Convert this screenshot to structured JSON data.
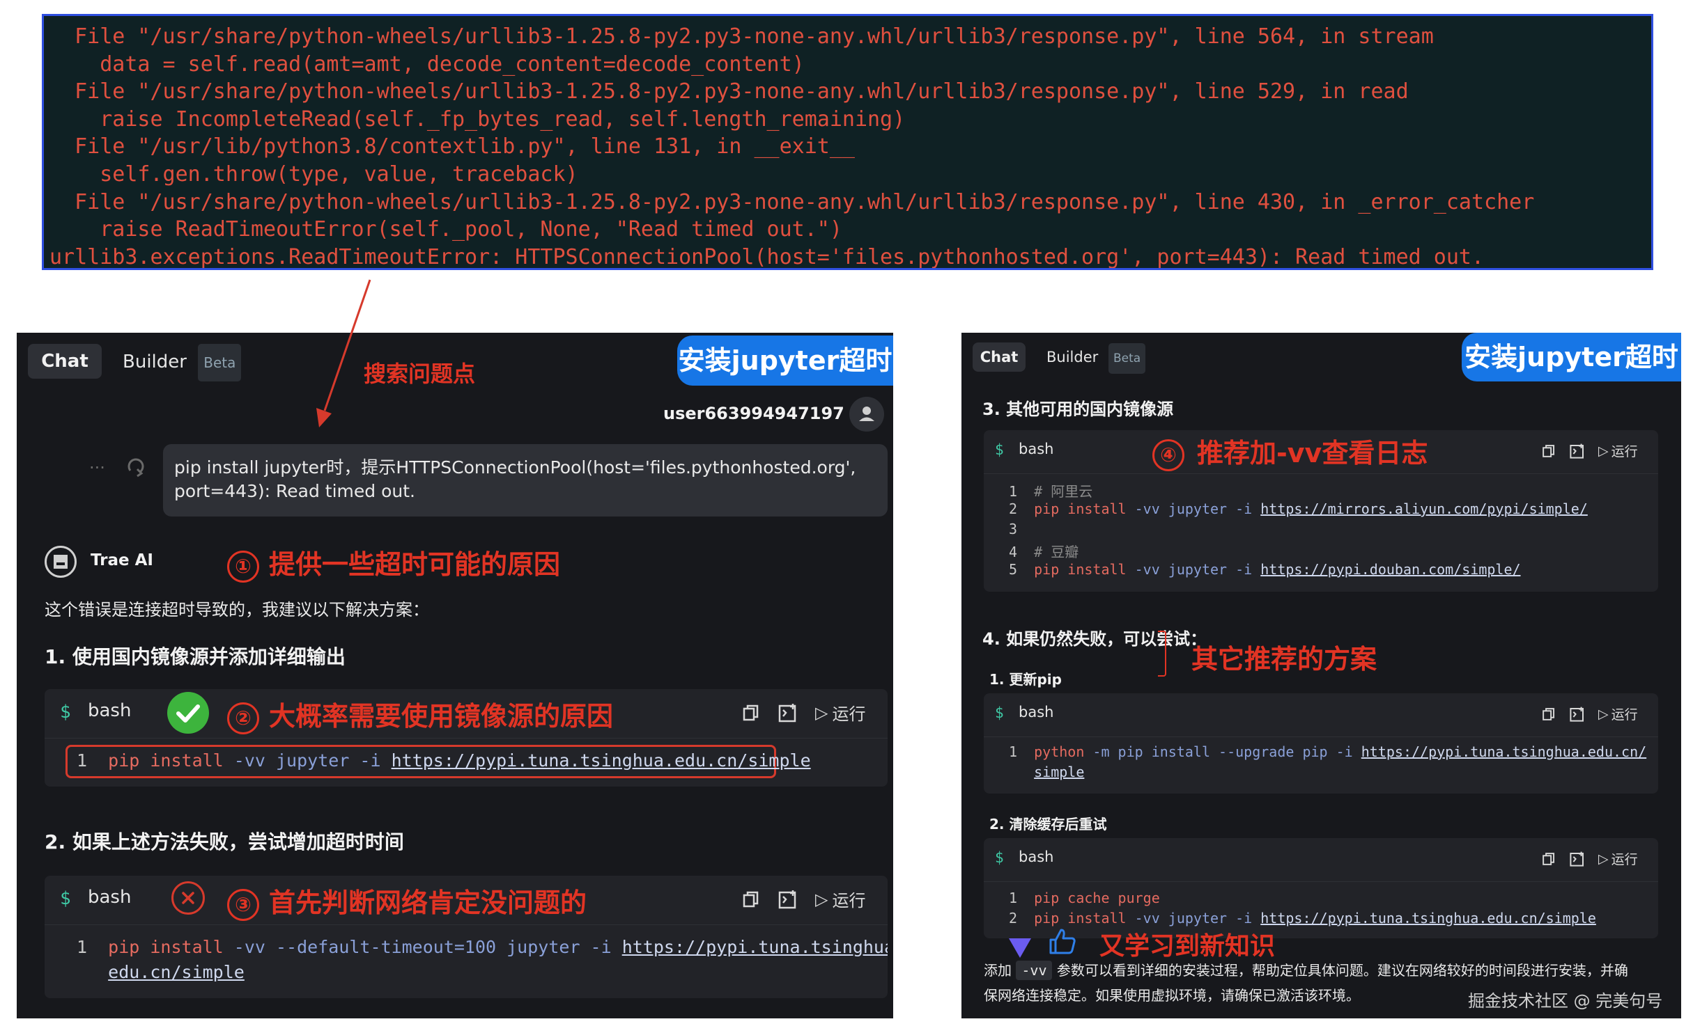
{
  "terminal": {
    "lines": [
      "  File \"/usr/share/python-wheels/urllib3-1.25.8-py2.py3-none-any.whl/urllib3/response.py\", line 564, in stream",
      "    data = self.read(amt=amt, decode_content=decode_content)",
      "  File \"/usr/share/python-wheels/urllib3-1.25.8-py2.py3-none-any.whl/urllib3/response.py\", line 529, in read",
      "    raise IncompleteRead(self._fp_bytes_read, self.length_remaining)",
      "  File \"/usr/lib/python3.8/contextlib.py\", line 131, in __exit__",
      "    self.gen.throw(type, value, traceback)",
      "  File \"/usr/share/python-wheels/urllib3-1.25.8-py2.py3-none-any.whl/urllib3/response.py\", line 430, in _error_catcher",
      "    raise ReadTimeoutError(self._pool, None, \"Read timed out.\")",
      "urllib3.exceptions.ReadTimeoutError: HTTPSConnectionPool(host='files.pythonhosted.org', port=443): Read timed out."
    ],
    "border_color": "#2f4fe0",
    "text_color": "#e0503f"
  },
  "left": {
    "tab_chat": "Chat",
    "tab_builder": "Builder",
    "beta": "Beta",
    "badge": "安装jupyter超时",
    "annot_search": "搜索问题点",
    "username": "user663994947197",
    "user_message": [
      "pip install jupyter时，提示HTTPSConnectionPool(host='files.pythonhosted.org',",
      "port=443): Read timed out."
    ],
    "ellipsis": "···",
    "ai_name": "Trae AI",
    "note1_num": "①",
    "note1": "提供一些超时可能的原因",
    "intro": "这个错误是连接超时导致的，我建议以下解决方案：",
    "h1": "1. 使用国内镜像源并添加详细输出",
    "code1_lang": "bash",
    "note2_num": "②",
    "note2": "大概率需要使用镜像源的原因",
    "copy_label": "运行",
    "code1": {
      "n": "1",
      "cmd": "pip install",
      "flags": " -vv jupyter -i ",
      "url": "https://pypi.tuna.tsinghua.edu.cn/simple"
    },
    "h2": "2. 如果上述方法失败，尝试增加超时时间",
    "code2_lang": "bash",
    "note3_num": "③",
    "note3": "首先判断网络肯定没问题的",
    "code2": {
      "n": "1",
      "cmd": "pip install",
      "flags": " -vv --default-timeout=100 jupyter -i ",
      "url1": "https://pypi.tuna.tsinghua.",
      "url2": "edu.cn/simple"
    }
  },
  "right": {
    "tab_chat": "Chat",
    "tab_builder": "Builder",
    "beta": "Beta",
    "badge": "安装jupyter超时",
    "h3": "3. 其他可用的国内镜像源",
    "code3_lang": "bash",
    "note4_num": "④",
    "note4": "推荐加-vv查看日志",
    "run_label": "运行",
    "code3": [
      {
        "n": "1",
        "comment": "# 阿里云"
      },
      {
        "n": "2",
        "cmd": "pip install",
        "flags": " -vv jupyter -i ",
        "url": "https://mirrors.aliyun.com/pypi/simple/"
      },
      {
        "n": "3"
      },
      {
        "n": "4",
        "comment": "# 豆瓣"
      },
      {
        "n": "5",
        "cmd": "pip install",
        "flags": " -vv jupyter -i ",
        "url": "https://pypi.douban.com/simple/"
      }
    ],
    "h4": "4. 如果仍然失败，可以尝试：",
    "annot_other": "其它推荐的方案",
    "sub1": "1. 更新pip",
    "code4_lang": "bash",
    "code4": {
      "n": "1",
      "cmd": "python",
      "flags": " -m pip install --upgrade pip -i ",
      "url1": "https://pypi.tuna.tsinghua.edu.cn/",
      "url2": "simple"
    },
    "sub2": "2. 清除缓存后重试",
    "code5_lang": "bash",
    "code5": [
      {
        "n": "1",
        "cmd": "pip cache purge"
      },
      {
        "n": "2",
        "cmd": "pip install",
        "flags": " -vv jupyter -i ",
        "url": "https://pypi.tuna.tsinghua.edu.cn/simple"
      }
    ],
    "annot_learn": "又学习到新知识",
    "footer_prefix": "添加",
    "footer_code": "-vv",
    "footer_rest": "参数可以看到详细的安装过程，帮助定位具体问题。建议在网络较好的时间段进行安装，并确",
    "footer_line2": "保网络连接稳定。如果使用虚拟环境，请确保已激活该环境。",
    "watermark": "掘金技术社区 @ 完美句号"
  }
}
